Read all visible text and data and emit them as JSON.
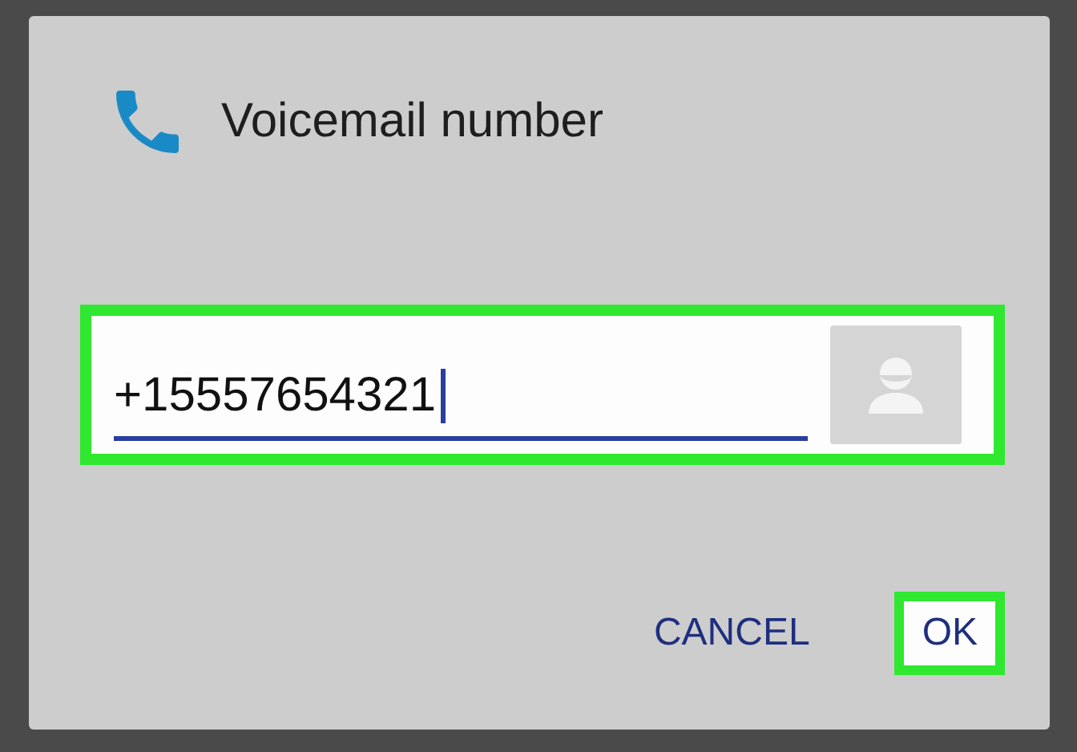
{
  "dialog": {
    "title": "Voicemail number"
  },
  "field": {
    "value": "+15557654321",
    "highlighted": true
  },
  "buttons": [
    {
      "label": "CANCEL",
      "highlighted": false
    },
    {
      "label": "OK",
      "highlighted": true
    }
  ]
}
